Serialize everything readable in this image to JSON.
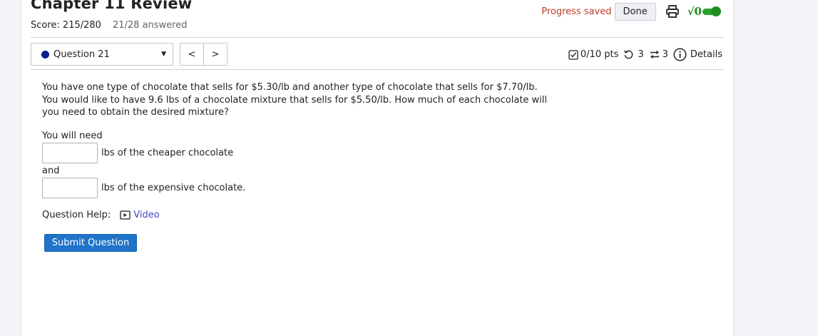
{
  "header": {
    "title": "Chapter 11 Review",
    "score": "Score: 215/280",
    "answered": "21/28 answered",
    "progress_saved": "Progress saved",
    "done_label": "Done",
    "print_icon": "printer-icon",
    "math_icon": "sqrt-icon",
    "math_icon_text": "√0"
  },
  "nav": {
    "question_label": "Question 21",
    "prev_label": "<",
    "next_label": ">"
  },
  "meta": {
    "points": "0/10 pts",
    "retries": "3",
    "attempts": "3",
    "details": "Details"
  },
  "question": {
    "text": "You have one type of chocolate that sells for $5.30/lb and another type of chocolate that sells for $7.70/lb. You would like to have 9.6 lbs of a chocolate mixture that sells for $5.50/lb. How much of each chocolate will you need to obtain the desired mixture?",
    "you_will_need": "You will need",
    "cheaper_label": "lbs of the cheaper chocolate",
    "and_label": "and",
    "expensive_label": "lbs of the expensive chocolate.",
    "cheaper_value": "",
    "expensive_value": ""
  },
  "help": {
    "label": "Question Help:",
    "video_label": "Video"
  },
  "submit_label": "Submit Question",
  "colors": {
    "progress_saved": "#c0392b",
    "toggle_on": "#27a22c",
    "submit_bg": "#1f73c8",
    "link": "#4a4ac0",
    "question_dot": "#0b1f8f"
  }
}
